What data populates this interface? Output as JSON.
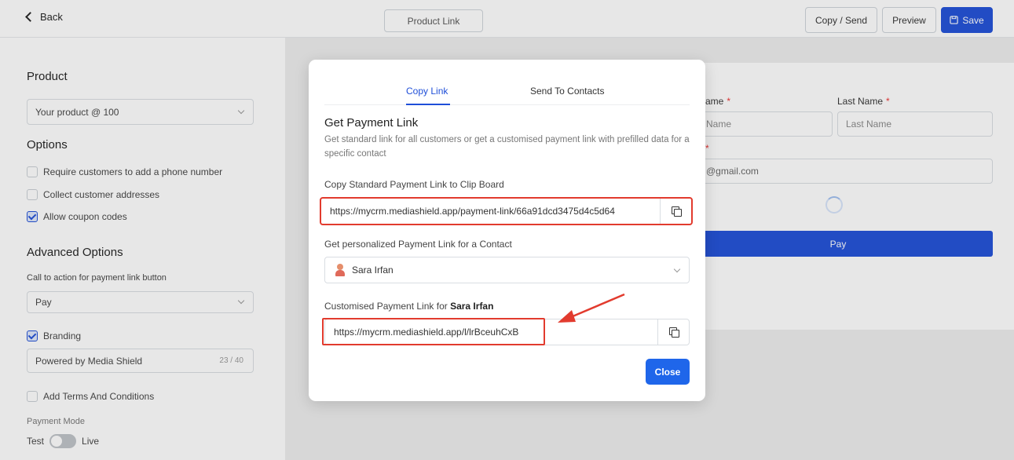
{
  "topbar": {
    "back_label": "Back",
    "center_title": "Product Link",
    "copy_send_label": "Copy / Send",
    "preview_label": "Preview",
    "save_label": "Save"
  },
  "left": {
    "product_title": "Product",
    "product_value": "Your product @ 100",
    "options_title": "Options",
    "options": [
      {
        "label": "Require customers to add a phone number",
        "checked": false
      },
      {
        "label": "Collect customer addresses",
        "checked": false
      },
      {
        "label": "Allow coupon codes",
        "checked": true
      }
    ],
    "advanced_title": "Advanced Options",
    "cta_label": "Call to action for payment link button",
    "cta_value": "Pay",
    "branding_label": "Branding",
    "branding_value": "Powered by Media Shield",
    "branding_count": "23 / 40",
    "terms_label": "Add Terms And Conditions",
    "payment_mode_label": "Payment Mode",
    "mode_test": "Test",
    "mode_live": "Live"
  },
  "preview": {
    "first_name_label": "ame",
    "last_name_label": "Last Name",
    "required_mark": "*",
    "first_name_placeholder": "Name",
    "last_name_placeholder": "Last Name",
    "email_value": "@gmail.com",
    "pay_label": "Pay"
  },
  "modal": {
    "tab_copy": "Copy Link",
    "tab_send": "Send To Contacts",
    "title": "Get Payment Link",
    "description": "Get standard link for all customers or get a customised payment link with prefilled data for a specific contact",
    "standard_label": "Copy Standard Payment Link to Clip Board",
    "standard_link": "https://mycrm.mediashield.app/payment-link/66a91dcd3475d4c5d64",
    "personal_label": "Get personalized Payment Link for a Contact",
    "contact_name": "Sara Irfan",
    "custom_label_prefix": "Customised Payment Link for ",
    "custom_label_name": "Sara Irfan",
    "custom_link": "https://mycrm.mediashield.app/l/lrBceuhCxB",
    "close_label": "Close"
  },
  "colors": {
    "accent": "#1f4fd8",
    "highlight": "#e23b2e"
  }
}
